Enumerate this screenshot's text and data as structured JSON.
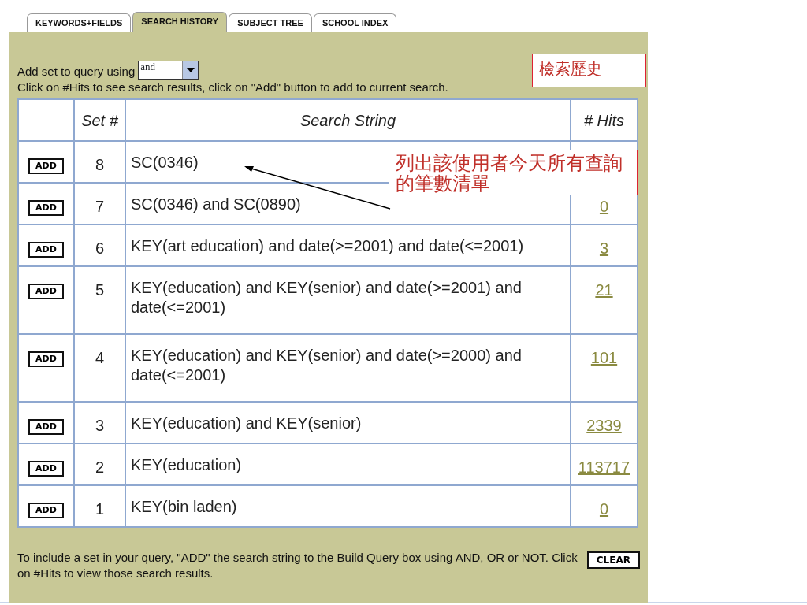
{
  "tabs": [
    {
      "label": "KEYWORDS+FIELDS",
      "selected": false
    },
    {
      "label": "SEARCH HISTORY",
      "selected": true
    },
    {
      "label": "SUBJECT TREE",
      "selected": false
    },
    {
      "label": "SCHOOL INDEX",
      "selected": false
    }
  ],
  "operator": {
    "label": "Add set to query using",
    "value": "and"
  },
  "instructions": "Click on #Hits to see search results, click on \"Add\" button to add to current search.",
  "table": {
    "columns": [
      "Set #",
      "Search String",
      "# Hits"
    ],
    "rows": [
      {
        "add": "ADD",
        "set": "8",
        "string": "SC(0346)"
      },
      {
        "add": "ADD",
        "set": "7",
        "string": "SC(0346) and SC(0890)",
        "hits": "0"
      },
      {
        "add": "ADD",
        "set": "6",
        "string": "KEY(art education) and date(>=2001) and date(<=2001)",
        "hits": "3"
      },
      {
        "add": "ADD",
        "set": "5",
        "string": "KEY(education) and KEY(senior) and date(>=2001) and date(<=2001)",
        "hits": "21"
      },
      {
        "add": "ADD",
        "set": "4",
        "string": "KEY(education) and KEY(senior) and date(>=2000) and date(<=2001)",
        "hits": "101"
      },
      {
        "add": "ADD",
        "set": "3",
        "string": "KEY(education) and KEY(senior)",
        "hits": "2339"
      },
      {
        "add": "ADD",
        "set": "2",
        "string": "KEY(education)",
        "hits": "113717"
      },
      {
        "add": "ADD",
        "set": "1",
        "string": "KEY(bin laden)",
        "hits": "0"
      }
    ]
  },
  "footer": "To include a set in your query, \"ADD\" the search string to the Build Query box using AND, OR or NOT. Click on #Hits to view those search results.",
  "clear_button": "CLEAR",
  "callouts": [
    "檢索歷史",
    "列出該使用者今天所有查詢的筆數清單"
  ]
}
